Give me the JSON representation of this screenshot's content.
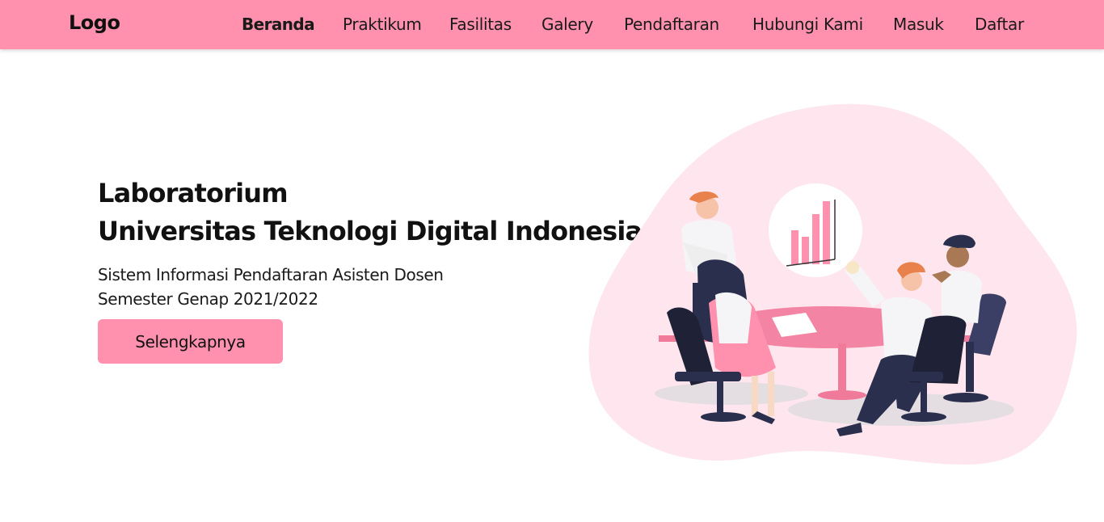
{
  "header": {
    "logo": "Logo",
    "nav": [
      {
        "label": "Beranda",
        "active": true
      },
      {
        "label": "Praktikum"
      },
      {
        "label": "Fasilitas"
      },
      {
        "label": "Galery"
      },
      {
        "label": "Pendaftaran"
      },
      {
        "label": "Hubungi Kami"
      },
      {
        "label": "Masuk"
      },
      {
        "label": "Daftar"
      }
    ]
  },
  "hero": {
    "title_line1": "Laboratorium",
    "title_line2": "Universitas Teknologi Digital Indonesia",
    "subtitle_line1": "Sistem Informasi Pendaftaran Asisten Dosen",
    "subtitle_line2": "Semester Genap 2021/2022",
    "button_label": "Selengkapnya"
  },
  "colors": {
    "brand": "#ff91af",
    "blob": "#ffe6ee",
    "navy": "#2b2f4e"
  }
}
